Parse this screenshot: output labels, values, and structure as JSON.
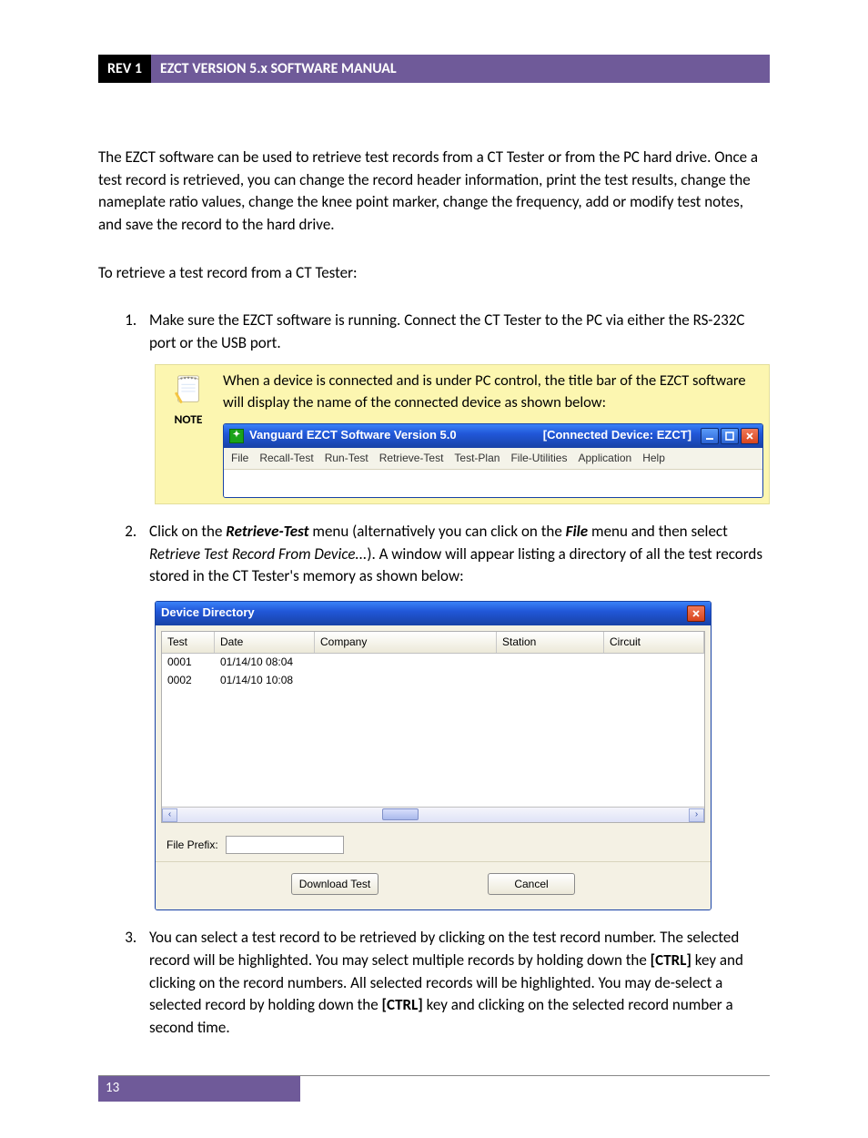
{
  "header": {
    "rev": "REV 1",
    "title": "EZCT VERSION 5.x SOFTWARE MANUAL"
  },
  "intro_para": "The EZCT software can be used to retrieve test records from a CT Tester or from the PC hard drive. Once a test record is retrieved, you can change the record header information, print the test results, change the nameplate ratio values, change the knee point marker, change the frequency, add or modify test notes, and save the record to the hard drive.",
  "retrieve_intro": "To retrieve a test record from a CT Tester:",
  "step1": "Make sure the EZCT software is running. Connect the CT Tester to the PC via either the RS-232C port or the USB port.",
  "note": {
    "label": "NOTE",
    "text": "When a device is connected and is under PC control, the title bar of the EZCT software will display the name of the connected device as shown below:"
  },
  "app_window": {
    "title_left": "Vanguard EZCT Software Version 5.0",
    "title_right": "[Connected Device:  EZCT]",
    "menus": [
      "File",
      "Recall-Test",
      "Run-Test",
      "Retrieve-Test",
      "Test-Plan",
      "File-Utilities",
      "Application",
      "Help"
    ]
  },
  "step2": {
    "prefix": "Click on the ",
    "menu1": "Retrieve-Test",
    "mid1": " menu (alternatively you can click on the ",
    "menu2": "File",
    "mid2": " menu and then select ",
    "menuitem": "Retrieve Test Record From Device...",
    "suffix": "). A window will appear listing a directory of all the test records stored in the CT Tester's memory as shown below:"
  },
  "dialog": {
    "title": "Device Directory",
    "columns": [
      "Test",
      "Date",
      "Company",
      "Station",
      "Circuit"
    ],
    "rows": [
      {
        "test": "0001",
        "date": "01/14/10 08:04",
        "company": "",
        "station": "",
        "circuit": ""
      },
      {
        "test": "0002",
        "date": "01/14/10 10:08",
        "company": "",
        "station": "",
        "circuit": ""
      }
    ],
    "fileprefix_label": "File Prefix:",
    "fileprefix_value": "",
    "download_btn": "Download Test",
    "cancel_btn": "Cancel"
  },
  "step3": {
    "t1": "You can select a test record to be retrieved by clicking on the test record number. The selected record will be highlighted. You may select multiple records by holding down the ",
    "ctrl1": "[CTRL]",
    "t2": " key and clicking on the record numbers. All selected records will be highlighted. You may de-select a selected record by holding down the ",
    "ctrl2": "[CTRL]",
    "t3": " key and clicking on the selected record number a second time."
  },
  "page_number": "13"
}
